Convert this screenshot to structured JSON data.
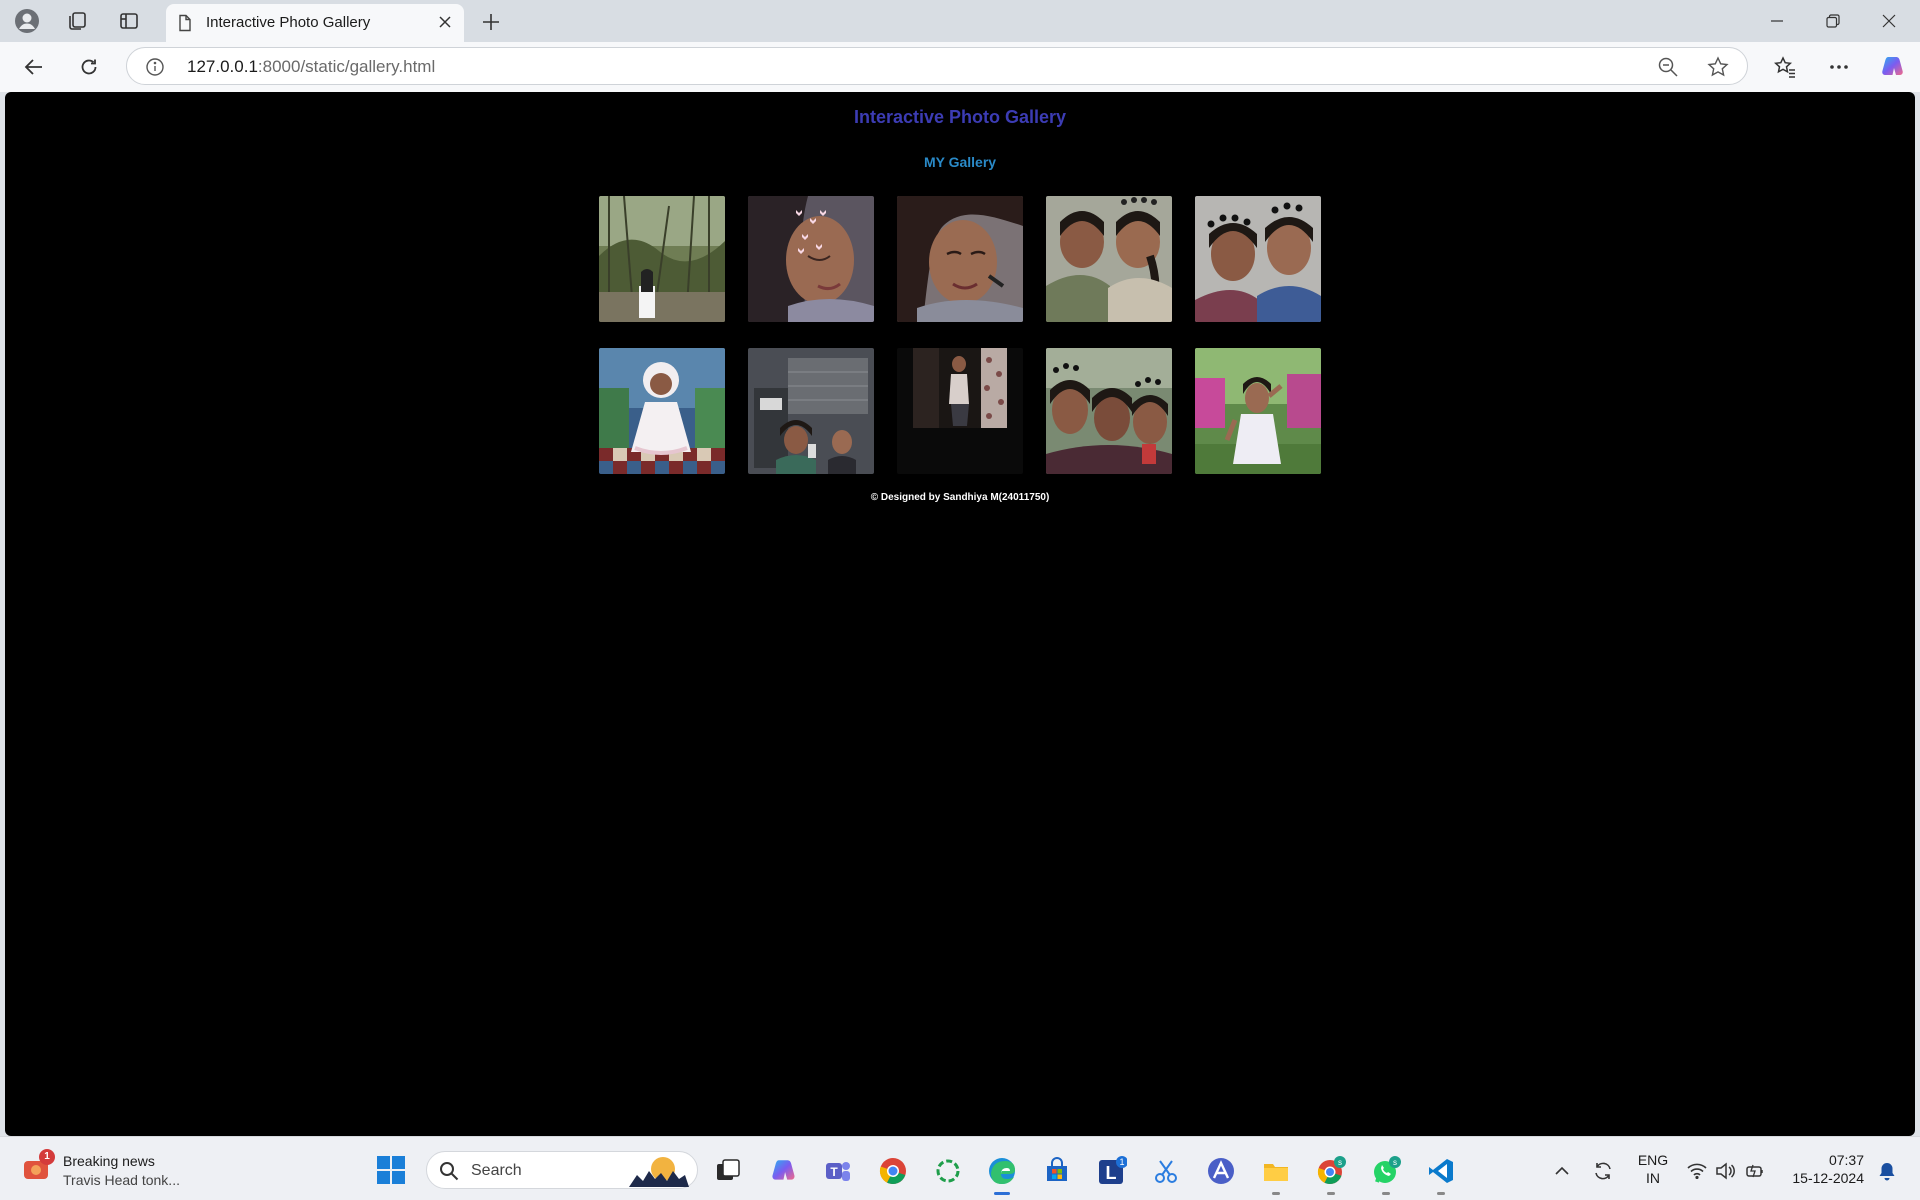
{
  "browser": {
    "tab_title": "Interactive Photo Gallery",
    "url_host": "127.0.0.1",
    "url_path": ":8000/static/gallery.html"
  },
  "page": {
    "title": "Interactive Photo Gallery",
    "gallery_heading": "MY Gallery",
    "footer": "© Designed by Sandhiya M(24011750)",
    "photos": [
      {
        "subject": "woman-among-mangrove-trees"
      },
      {
        "subject": "selfie-with-heart-filter"
      },
      {
        "subject": "selfie-portrait"
      },
      {
        "subject": "two-friends-selfie"
      },
      {
        "subject": "two-friends-with-heart-filter"
      },
      {
        "subject": "child-in-white-dress"
      },
      {
        "subject": "mirror-selfie-in-room"
      },
      {
        "subject": "mirror-selfie-dark-room"
      },
      {
        "subject": "group-selfie-three-friends"
      },
      {
        "subject": "girl-in-garden"
      }
    ]
  },
  "taskbar": {
    "news_badge": "1",
    "news_title": "Breaking news",
    "news_subtitle": "Travis Head tonk...",
    "search_label": "Search",
    "lang_line1": "ENG",
    "lang_line2": "IN",
    "time": "07:37",
    "date": "15-12-2024",
    "notification_badge": "1",
    "whatsapp_badge": "s",
    "chrome_badge": "s"
  },
  "colors": {
    "page_background": "#000000",
    "title_color": "#3c3cb4",
    "heading_color": "#2a8ac8",
    "footer_color": "#ffffff"
  }
}
